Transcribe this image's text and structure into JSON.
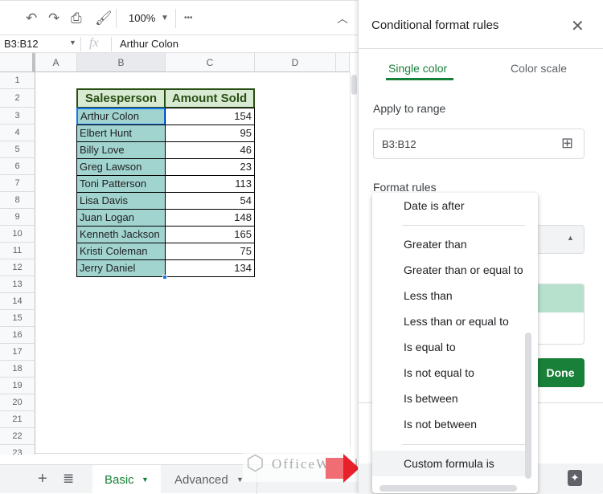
{
  "toolbar": {
    "zoom": "100%",
    "more": "•••",
    "icons": [
      "undo-icon",
      "redo-icon",
      "print-icon",
      "paint-format-icon"
    ]
  },
  "formula_bar": {
    "name_box": "B3:B12",
    "fx": "fx",
    "value": "Arthur Colon"
  },
  "columns": [
    "A",
    "B",
    "C",
    "D"
  ],
  "rows": [
    "1",
    "2",
    "3",
    "4",
    "5",
    "6",
    "7",
    "8",
    "9",
    "10",
    "11",
    "12",
    "13",
    "14",
    "15",
    "16",
    "17",
    "18",
    "19",
    "20",
    "21",
    "22",
    "23"
  ],
  "table": {
    "headers": [
      "Salesperson",
      "Amount Sold"
    ],
    "rows": [
      [
        "Arthur Colon",
        "154"
      ],
      [
        "Elbert Hunt",
        "95"
      ],
      [
        "Billy Love",
        "46"
      ],
      [
        "Greg Lawson",
        "23"
      ],
      [
        "Toni Patterson",
        "113"
      ],
      [
        "Lisa Davis",
        "54"
      ],
      [
        "Juan Logan",
        "148"
      ],
      [
        "Kenneth Jackson",
        "165"
      ],
      [
        "Kristi Coleman",
        "75"
      ],
      [
        "Jerry Daniel",
        "134"
      ]
    ]
  },
  "sheet_tabs": [
    {
      "label": "Basic",
      "active": true
    },
    {
      "label": "Advanced",
      "active": false
    }
  ],
  "watermark": "OfficeWheel",
  "panel": {
    "title": "Conditional format rules",
    "tabs": [
      "Single color",
      "Color scale"
    ],
    "apply_label": "Apply to range",
    "range": "B3:B12",
    "format_rules_label": "Format rules",
    "done": "Done",
    "accent": "#188038",
    "done_color": "#188038"
  },
  "menu": {
    "items": [
      "Date is after",
      "Greater than",
      "Greater than or equal to",
      "Less than",
      "Less than or equal to",
      "Is equal to",
      "Is not equal to",
      "Is between",
      "Is not between",
      "Custom formula is"
    ],
    "highlighted": "Custom formula is"
  }
}
